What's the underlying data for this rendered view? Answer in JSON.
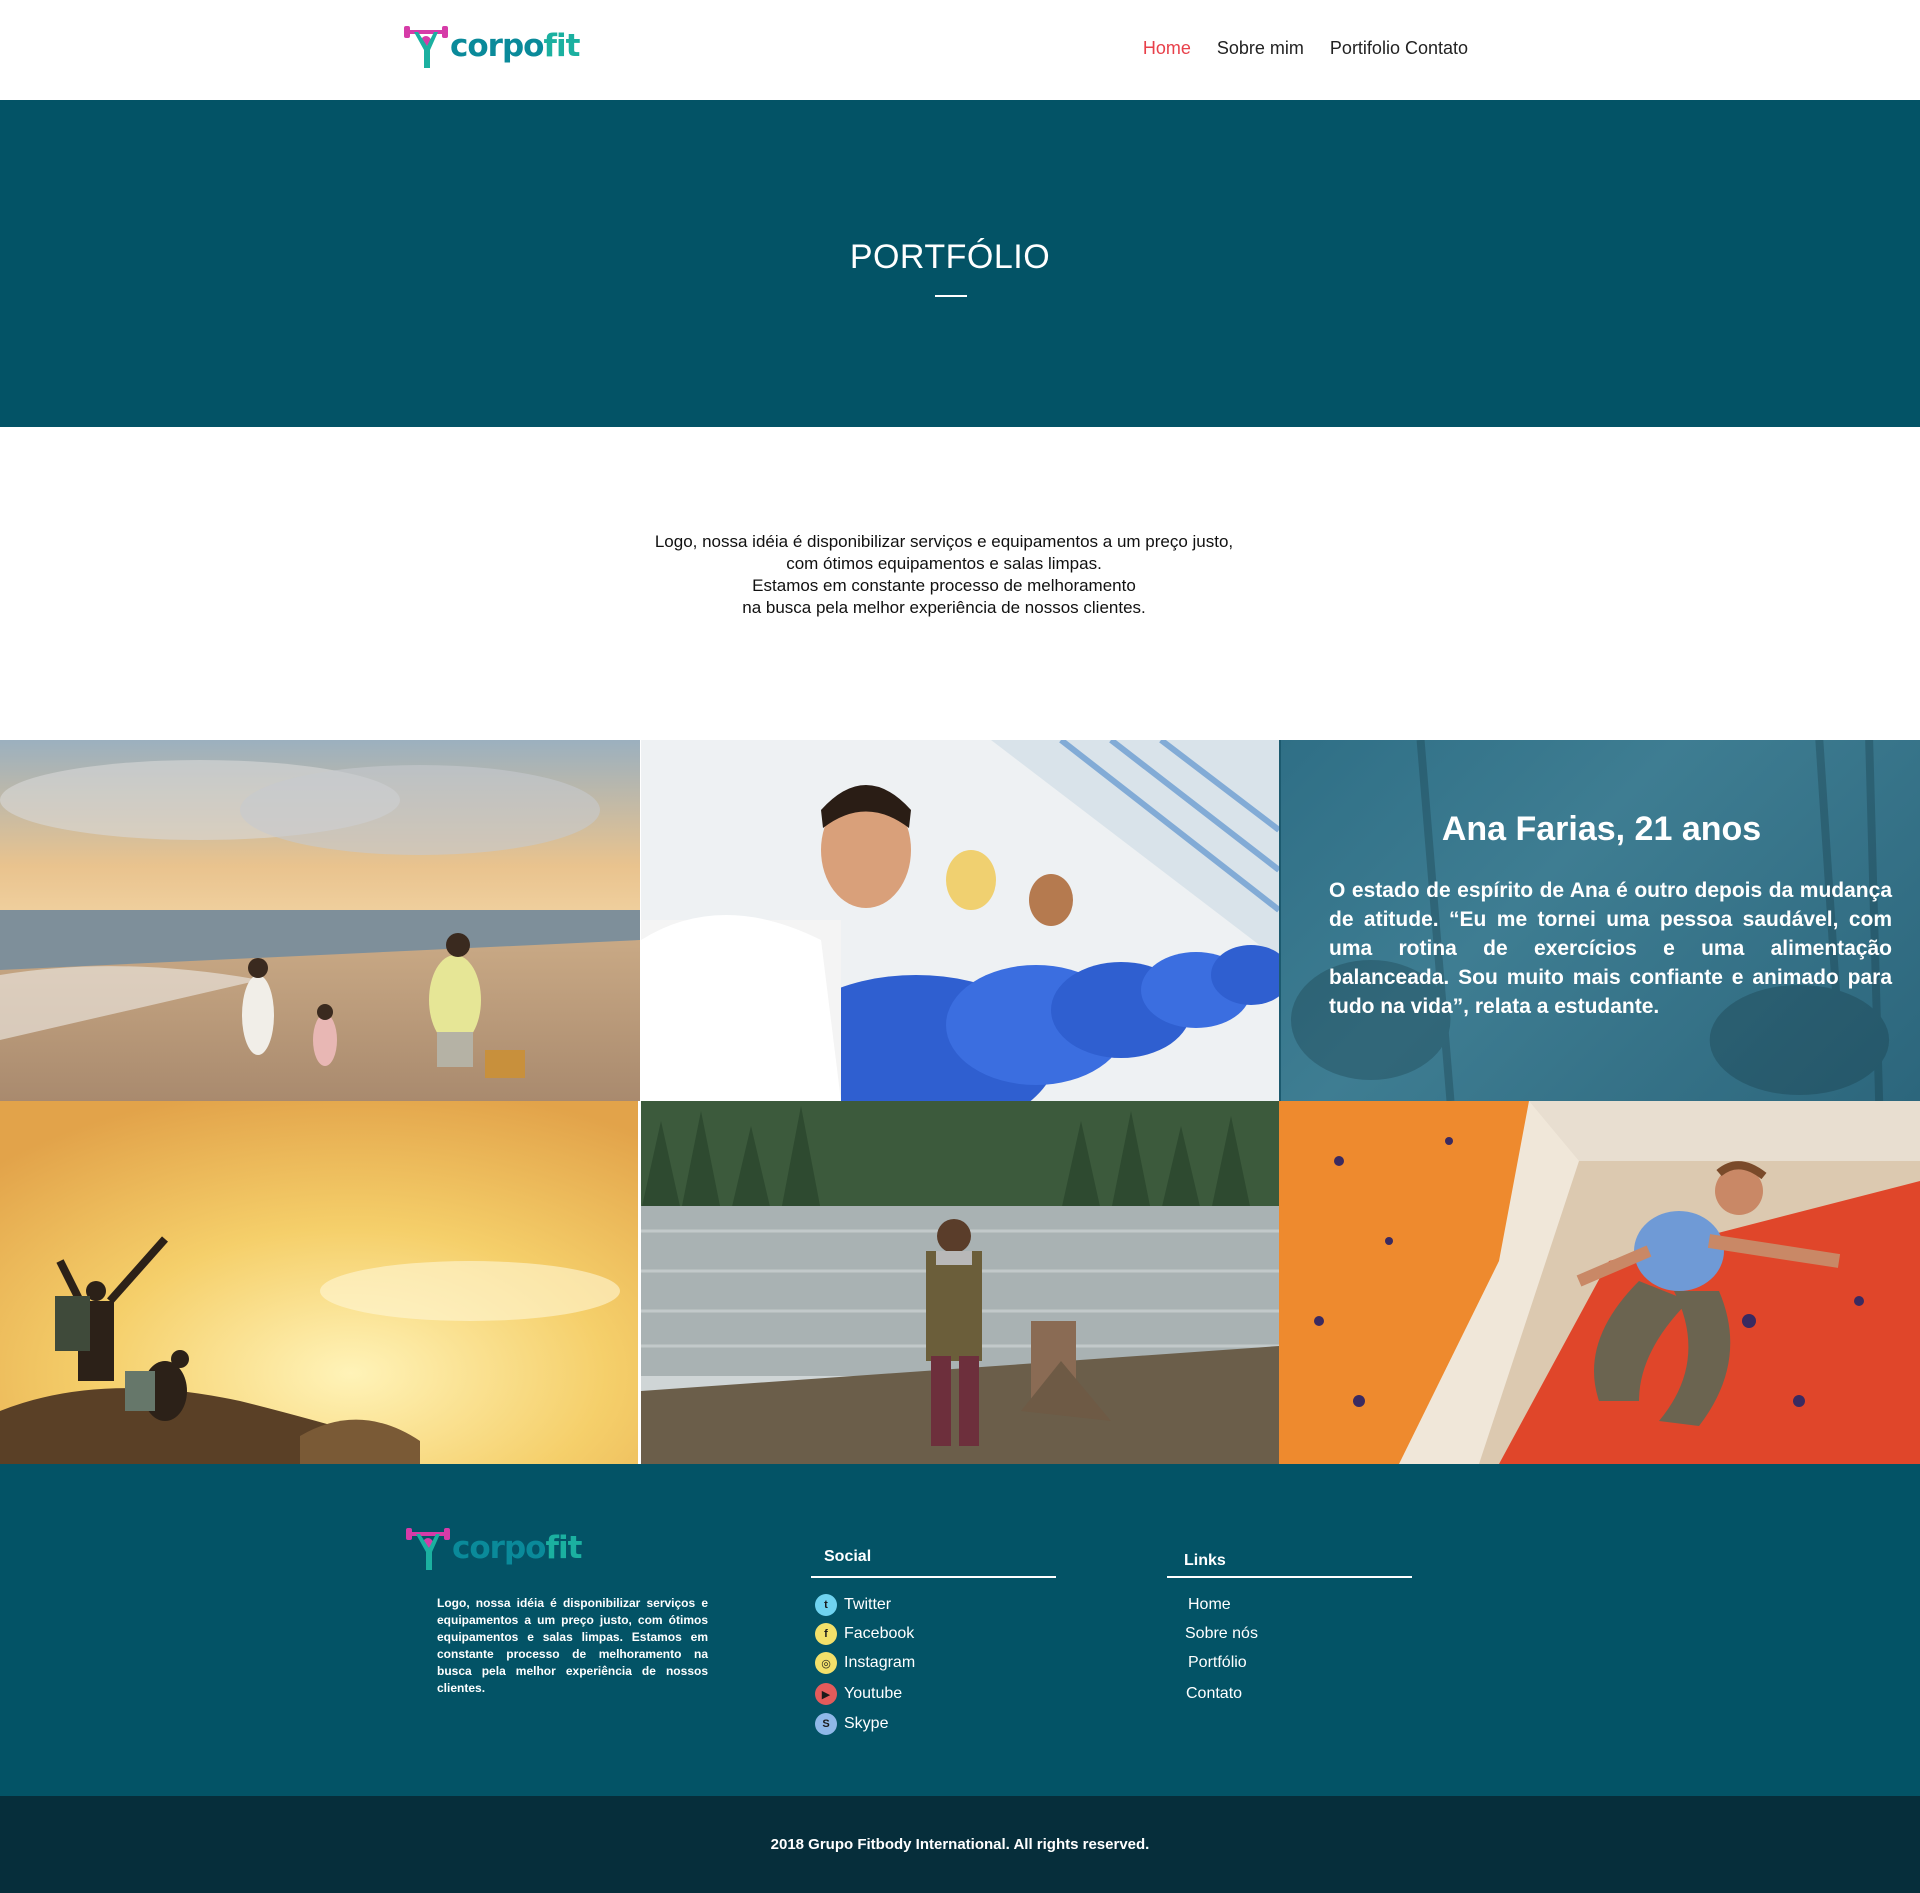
{
  "header": {
    "logo_text_a": "corpo",
    "logo_text_b": "fit",
    "nav": [
      "Home",
      "Sobre mim",
      "Portifolio Contato"
    ]
  },
  "hero": {
    "title": "PORTFÓLIO"
  },
  "intro": {
    "lines": [
      "Logo, nossa idéia é disponibilizar serviços e equipamentos a um preço justo,",
      "com ótimos equipamentos e salas limpas.",
      "Estamos em constante processo de melhoramento",
      "na busca pela melhor experiência de nossos clientes."
    ]
  },
  "story": {
    "title": "Ana Farias, 21 anos",
    "text": "O estado de espírito de Ana é outro depois da mudança de atitude. “Eu me tornei uma pessoa saudável, com uma rotina de exercícios e uma alimentação balanceada. Sou muito mais confiante e animado para tudo na vida”, relata a estudante."
  },
  "footer": {
    "about": "Logo, nossa idéia é disponibilizar serviços e equipamentos a um preço justo, com ótimos equipamentos e salas limpas. Estamos em constante processo de melhoramento na busca pela melhor experiência de nossos clientes.",
    "social_title": "Social",
    "social": [
      {
        "label": "Twitter",
        "icon": "twitter-icon",
        "glyph": "t",
        "color": "#6fd3f0"
      },
      {
        "label": "Facebook",
        "icon": "facebook-icon",
        "glyph": "f",
        "color": "#f3e06a"
      },
      {
        "label": "Instagram",
        "icon": "instagram-icon",
        "glyph": "◎",
        "color": "#f3e06a"
      },
      {
        "label": "Youtube",
        "icon": "youtube-icon",
        "glyph": "▶",
        "color": "#e35b5b"
      },
      {
        "label": "Skype",
        "icon": "skype-icon",
        "glyph": "S",
        "color": "#8fb8e8"
      }
    ],
    "links_title": "Links",
    "links": [
      "Home",
      "Sobre nós",
      "Portfólio",
      "Contato"
    ]
  },
  "copyright": "2018 Grupo Fitbody International. All rights reserved.",
  "colors": {
    "primary": "#035366",
    "dark": "#062e3b",
    "accent": "#e8404a"
  }
}
